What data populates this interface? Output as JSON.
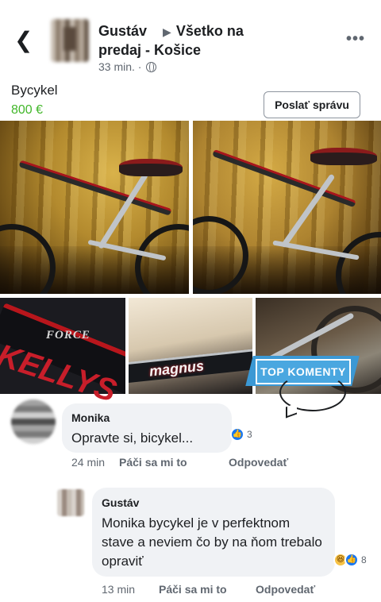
{
  "header": {
    "name": "Gustáv",
    "group_line1": "Všetko na",
    "group_line2": "predaj - Košice",
    "time": "33 min. ·",
    "icons": [
      "back-arrow-icon",
      "globe-icon",
      "more-options-icon",
      "triangle-arrow-icon"
    ]
  },
  "listing": {
    "title": "Bycykel",
    "price": "800 €",
    "price_color": "#42b72a",
    "message_button": "Poslať správu"
  },
  "photos": {
    "count": 5,
    "overlay_texts": {
      "force": "FORCE",
      "kellys": "KELLYS",
      "magnus": "magnus"
    }
  },
  "badge": {
    "label": "TOP KOMENTY",
    "color": "#4aa7e0"
  },
  "comments": [
    {
      "author": "Monika",
      "text": "Opravte si, bicykel...",
      "reaction_count": "3",
      "time": "24 min",
      "like_label": "Páči sa mi to",
      "reply_label": "Odpovedať"
    },
    {
      "author": "Gustáv",
      "text": "Monika bycykel je v perfektnom stave a neviem čo by na ňom trebalo opraviť",
      "reaction_count": "8",
      "time": "13 min",
      "like_label": "Páči sa mi to",
      "reply_label": "Odpovedať"
    }
  ]
}
